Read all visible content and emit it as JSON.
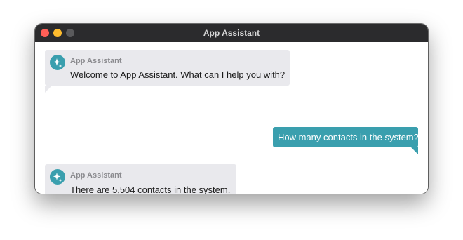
{
  "window": {
    "title": "App Assistant"
  },
  "conversation": {
    "messages": [
      {
        "role": "assistant",
        "sender": "App Assistant",
        "text": "Welcome to App Assistant. What can I help you with?"
      },
      {
        "role": "user",
        "text": "How many contacts in the system?"
      },
      {
        "role": "assistant",
        "sender": "App Assistant",
        "text": "There are 5,504 contacts in the system."
      }
    ]
  },
  "colors": {
    "accent": "#3a9fae",
    "assistant_bubble": "#e9e9ed",
    "titlebar": "#2b2b2d"
  },
  "icons": {
    "assistant_avatar": "sparkle-icon"
  }
}
